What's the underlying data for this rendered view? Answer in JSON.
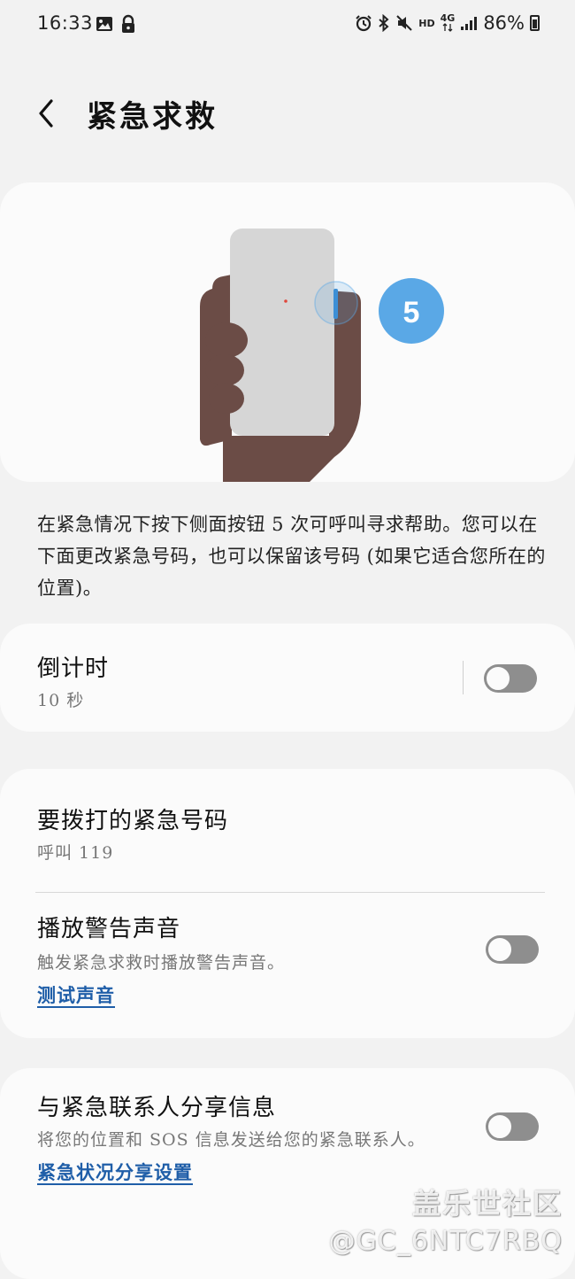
{
  "status_bar": {
    "time": "16:33",
    "left_icons": [
      "image-icon",
      "lock-icon"
    ],
    "right_icons": [
      "alarm-icon",
      "bluetooth-icon",
      "mute-icon",
      "hd-icon",
      "4g-icon",
      "signal-icon"
    ],
    "hd_label": "HD",
    "network_label": "4G",
    "battery_percent": "86%"
  },
  "header": {
    "title": "紧急求救"
  },
  "illustration": {
    "press_count": "5",
    "accent_color": "#5aa8e6",
    "hand_color": "#6b4c46",
    "phone_color": "#d6d6d6"
  },
  "description": "在紧急情况下按下侧面按钮 5 次可呼叫寻求帮助。您可以在下面更改紧急号码，也可以保留该号码 (如果它适合您所在的位置)。",
  "countdown": {
    "title": "倒计时",
    "value": "10 秒",
    "enabled": false
  },
  "emergency_number": {
    "title": "要拨打的紧急号码",
    "value": "呼叫 119"
  },
  "alarm_sound": {
    "title": "播放警告声音",
    "subtitle": "触发紧急求救时播放警告声音。",
    "link": "测试声音",
    "enabled": false
  },
  "share_info": {
    "title": "与紧急联系人分享信息",
    "subtitle": "将您的位置和 SOS 信息发送给您的紧急联系人。",
    "link": "紧急状况分享设置",
    "enabled": false
  },
  "watermark": {
    "brand": "盖乐世社区",
    "user": "@GC_6NTC7RBQ"
  }
}
